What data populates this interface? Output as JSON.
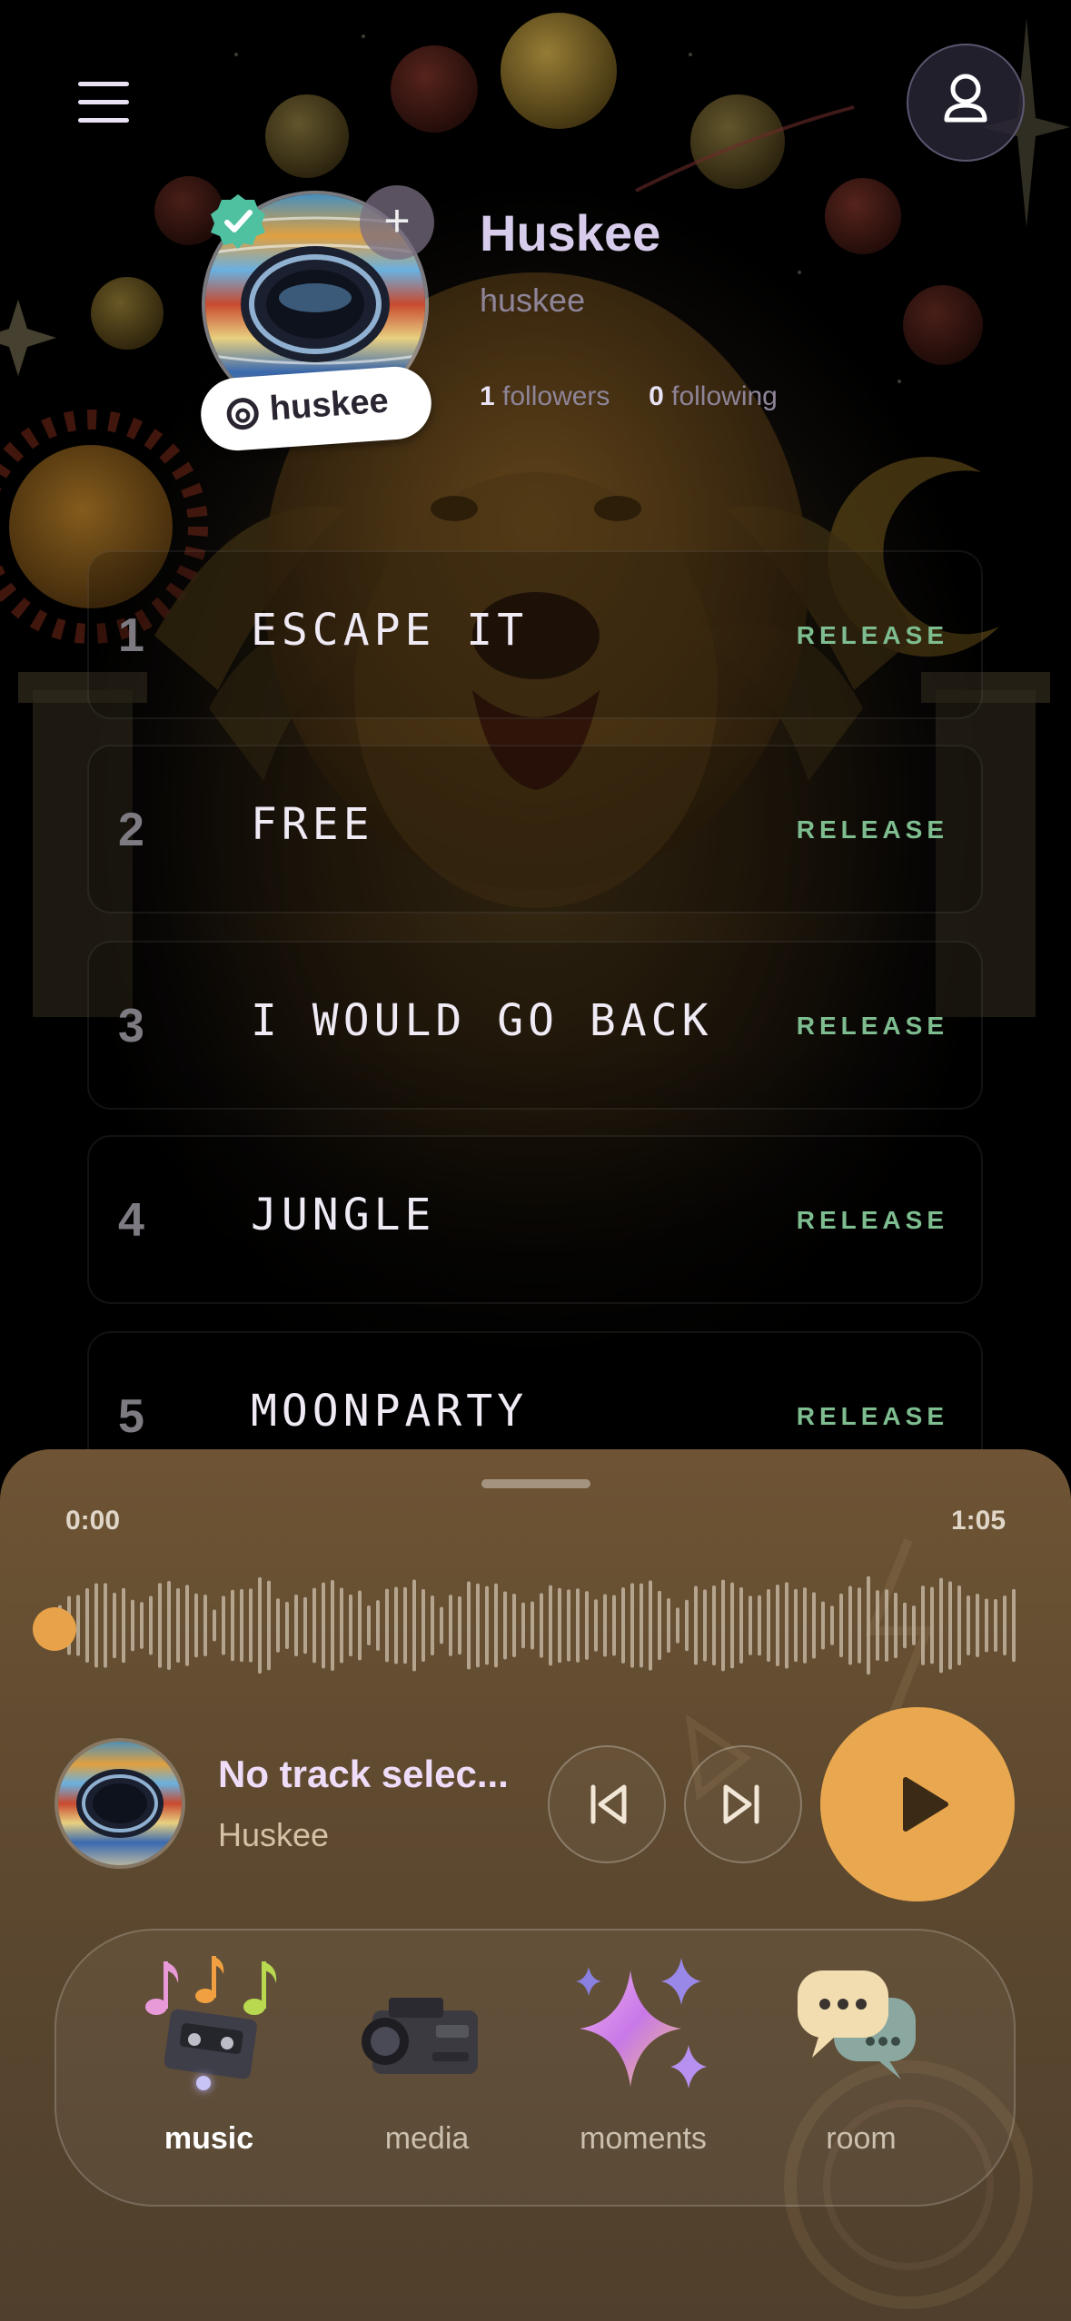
{
  "header": {
    "menu_icon": "hamburger-menu-icon",
    "profile_icon": "user-icon"
  },
  "artist": {
    "display_name": "Huskee",
    "username": "huskee",
    "handle_label": "huskee",
    "followers_count": "1",
    "followers_label": "followers",
    "following_count": "0",
    "following_label": "following",
    "verified_icon": "verified-check-icon",
    "follow_icon": "plus-icon"
  },
  "tracks": [
    {
      "num": "1",
      "title": "ESCAPE IT",
      "tag": "RELEASE"
    },
    {
      "num": "2",
      "title": "FREE",
      "tag": "RELEASE"
    },
    {
      "num": "3",
      "title": "I WOULD GO BACK",
      "tag": "RELEASE"
    },
    {
      "num": "4",
      "title": "JUNGLE",
      "tag": "RELEASE"
    },
    {
      "num": "5",
      "title": "MOONPARTY",
      "tag": "RELEASE"
    }
  ],
  "player": {
    "elapsed": "0:00",
    "duration": "1:05",
    "progress": 0,
    "track_title": "No track selec...",
    "artist": "Huskee",
    "prev_icon": "skip-previous-icon",
    "next_icon": "skip-next-icon",
    "play_icon": "play-icon"
  },
  "nav": {
    "items": [
      {
        "label": "music",
        "icon": "music-cassette-icon",
        "active": true
      },
      {
        "label": "media",
        "icon": "camcorder-icon",
        "active": false
      },
      {
        "label": "moments",
        "icon": "sparkles-icon",
        "active": false
      },
      {
        "label": "room",
        "icon": "chat-bubbles-icon",
        "active": false
      }
    ]
  },
  "colors": {
    "accent_orange": "#E9A84F",
    "release_green": "#7EBD8F",
    "sheet_brown": "#6E5434",
    "name_lavender": "#D8CCEC"
  }
}
